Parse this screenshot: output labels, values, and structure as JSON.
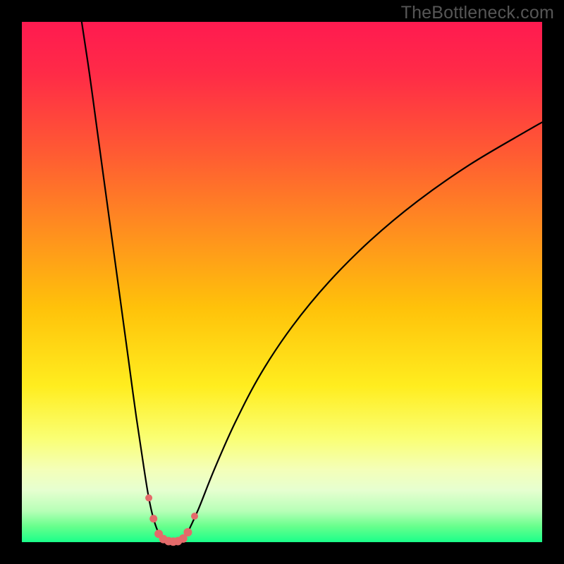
{
  "watermark": {
    "text": "TheBottleneck.com"
  },
  "colors": {
    "frame": "#000000",
    "gradient_stops": [
      {
        "pct": 0,
        "color": "#ff1a50"
      },
      {
        "pct": 10,
        "color": "#ff2b47"
      },
      {
        "pct": 25,
        "color": "#ff5a33"
      },
      {
        "pct": 40,
        "color": "#ff8e1f"
      },
      {
        "pct": 55,
        "color": "#ffc20a"
      },
      {
        "pct": 70,
        "color": "#ffed1f"
      },
      {
        "pct": 80,
        "color": "#faff73"
      },
      {
        "pct": 86,
        "color": "#f4ffb8"
      },
      {
        "pct": 90,
        "color": "#e6ffd0"
      },
      {
        "pct": 94,
        "color": "#b7ffb7"
      },
      {
        "pct": 97,
        "color": "#66ff8c"
      },
      {
        "pct": 100,
        "color": "#1aff8a"
      }
    ],
    "curve_stroke": "#000000",
    "marker_fill": "#e46a6a",
    "marker_stroke": "#c75454"
  },
  "chart_data": {
    "type": "line",
    "title": "",
    "xlabel": "",
    "ylabel": "",
    "xlim": [
      0,
      100
    ],
    "ylim": [
      0,
      100
    ],
    "grid": false,
    "legend": false,
    "series": [
      {
        "name": "bottleneck-curve-left",
        "x": [
          11.5,
          13,
          14.5,
          16,
          17.5,
          19,
          20.5,
          22,
          23.5,
          24.4,
          25.3,
          26.3
        ],
        "y": [
          100,
          90,
          79,
          68,
          57,
          46,
          35,
          24,
          14,
          8.5,
          4.5,
          1.6
        ]
      },
      {
        "name": "bottleneck-curve-bottom",
        "x": [
          26.3,
          27.2,
          28.2,
          29.1,
          30.0,
          31.0,
          31.9
        ],
        "y": [
          1.6,
          0.6,
          0.2,
          0.1,
          0.2,
          0.7,
          1.9
        ]
      },
      {
        "name": "bottleneck-curve-right",
        "x": [
          31.9,
          34,
          37,
          41,
          46,
          52,
          59,
          67,
          76,
          86,
          97,
          100
        ],
        "y": [
          1.9,
          6.5,
          14,
          23,
          32.5,
          41.5,
          50,
          58,
          65.5,
          72.5,
          79,
          80.7
        ]
      }
    ],
    "markers": {
      "name": "highlighted-points",
      "x": [
        24.4,
        25.3,
        26.3,
        27.2,
        28.2,
        29.1,
        30.0,
        31.0,
        31.9,
        33.2
      ],
      "y": [
        8.5,
        4.5,
        1.6,
        0.6,
        0.2,
        0.1,
        0.2,
        0.7,
        1.9,
        5.0
      ],
      "r": [
        5,
        5.5,
        6,
        6,
        6,
        6,
        6,
        6,
        6,
        5
      ]
    }
  }
}
